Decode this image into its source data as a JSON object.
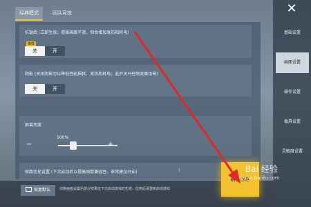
{
  "tabs": [
    {
      "label": "经典模式",
      "active": true
    },
    {
      "label": "团队竞技",
      "active": false
    }
  ],
  "settings": {
    "antialias": {
      "label": "抗锯齿 (立即生效；提高画面平滑，但会增加发热和耗电)",
      "badge": "推荐",
      "options": [
        "关",
        "开"
      ],
      "selected": "关"
    },
    "shadow": {
      "label": "阴影 (关闭阴影可以降低性能损耗、发热和耗电；此开关只控制竞赛场景)",
      "options": [
        "关",
        "开"
      ],
      "selected": "关"
    },
    "brightness": {
      "label": "屏幕亮度",
      "value_text": "100%",
      "level": 0.25,
      "minus": "−",
      "plus": "+"
    },
    "fourth": {
      "label": "帧数优化设置 (下次启动后以提高帧数兼容性，非常建议开启)",
      "info": "!"
    }
  },
  "sidebar": {
    "close": "✕",
    "items": [
      {
        "label": "基础设置",
        "active": false
      },
      {
        "label": "画面设置",
        "active": true
      },
      {
        "label": "操作设置",
        "active": false
      },
      {
        "label": "载具设置",
        "active": false
      },
      {
        "label": "灵敏度设置",
        "active": false
      }
    ]
  },
  "bottom": {
    "reset_label": "恢复默认",
    "note": "切换画面设置后部分效果在下次启动游戏时生效，应用后请重新启动游戏"
  },
  "confirm_label": "确认保存",
  "watermark": {
    "text": "Bai 经验",
    "url": "jingyan.baidu.com"
  },
  "colors": {
    "accent": "#f2c230",
    "arrow": "#e32626"
  }
}
